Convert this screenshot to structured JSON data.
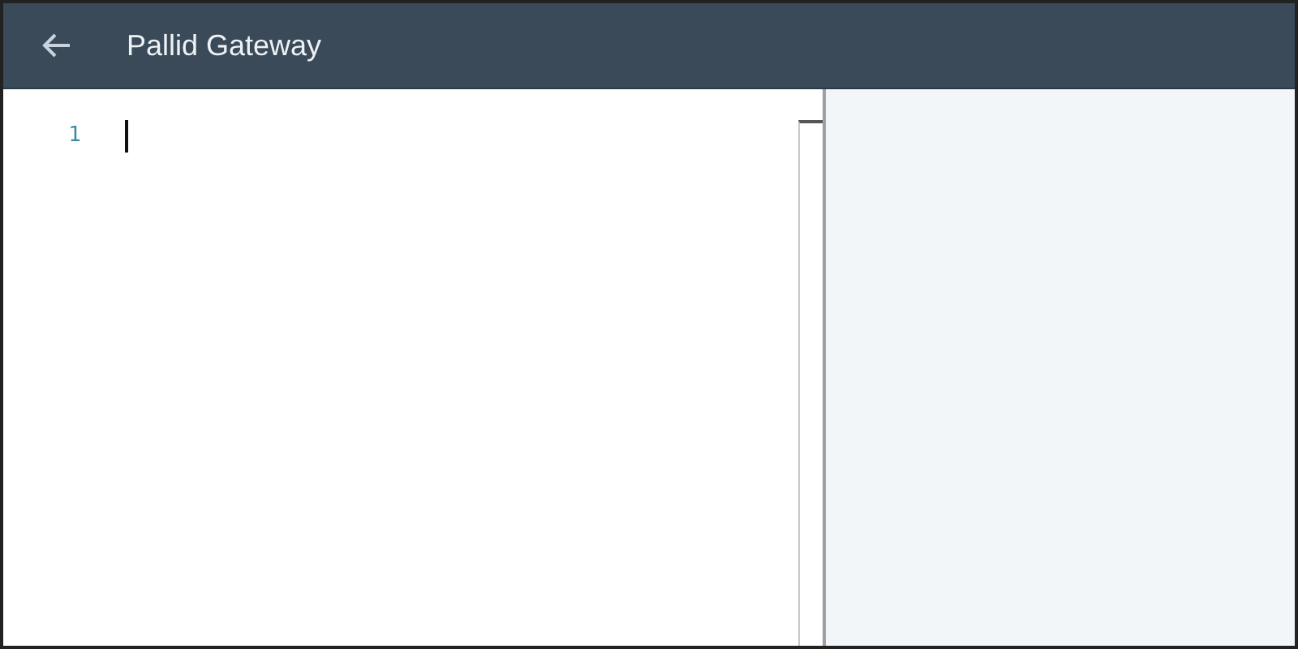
{
  "header": {
    "title": "Pallid Gateway"
  },
  "editor": {
    "line_numbers": [
      "1"
    ]
  }
}
